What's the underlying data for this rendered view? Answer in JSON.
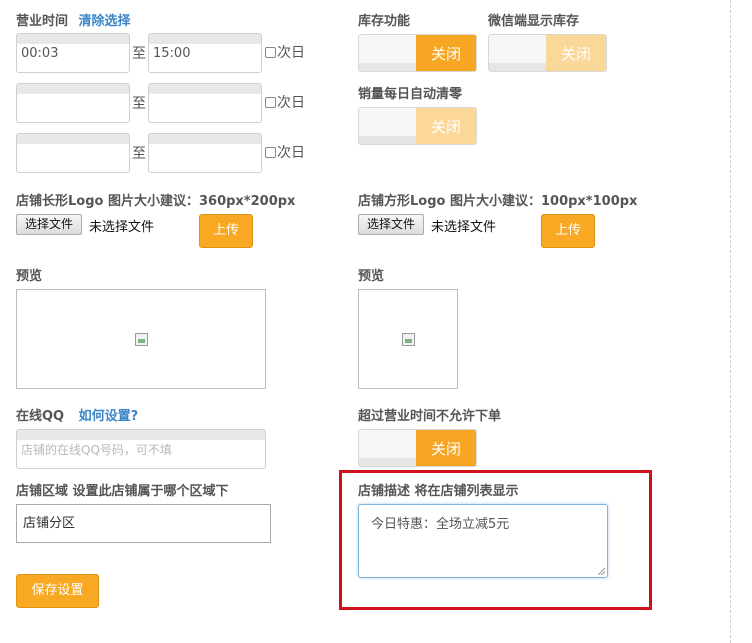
{
  "hours": {
    "label": "营业时间",
    "clear_link": "清除选择",
    "to_label": "至",
    "next_day_label": "次日",
    "rows": [
      {
        "start": "00:03",
        "end": "15:00"
      },
      {
        "start": "",
        "end": ""
      },
      {
        "start": "",
        "end": ""
      }
    ]
  },
  "inventory": {
    "label": "库存功能",
    "toggle_text": "关闭"
  },
  "wechat_inventory": {
    "label": "微信端显示库存",
    "toggle_text": "关闭"
  },
  "sales_reset": {
    "label": "销量每日自动清零",
    "toggle_text": "关闭"
  },
  "logo_long": {
    "label": "店铺长形Logo 图片大小建议：360px*200px",
    "choose_file": "选择文件",
    "no_file": "未选择文件",
    "upload": "上传",
    "preview_label": "预览"
  },
  "logo_square": {
    "label": "店铺方形Logo 图片大小建议：100px*100px",
    "choose_file": "选择文件",
    "no_file": "未选择文件",
    "upload": "上传",
    "preview_label": "预览"
  },
  "qq": {
    "label": "在线QQ",
    "help_link": "如何设置?",
    "placeholder": "店铺的在线QQ号码，可不填"
  },
  "after_hours": {
    "label": "超过营业时间不允许下单",
    "toggle_text": "关闭"
  },
  "region": {
    "label": "店铺区域  设置此店铺属于哪个区域下",
    "selected": "店铺分区"
  },
  "description": {
    "label": "店铺描述  将在店铺列表显示",
    "value": "今日特惠：全场立减5元"
  },
  "save_button": "保存设置",
  "colors": {
    "accent": "#f8a823",
    "toggle_dim": "#fbd89a",
    "link": "#3a86c8",
    "highlight": "#d0101b"
  }
}
